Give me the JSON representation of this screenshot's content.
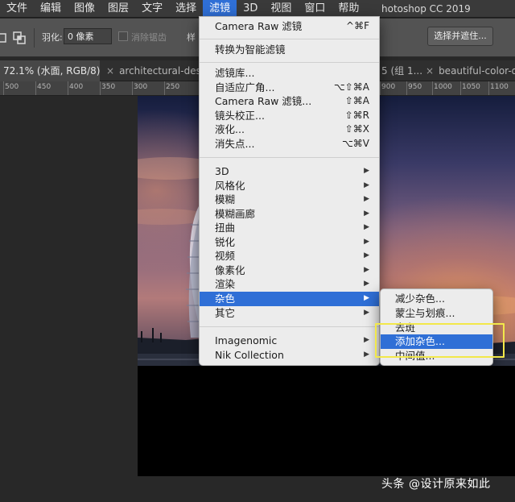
{
  "menubar": {
    "items": [
      "文件",
      "编辑",
      "图像",
      "图层",
      "文字",
      "选择",
      "滤镜",
      "3D",
      "视图",
      "窗口",
      "帮助"
    ],
    "active_index": 6,
    "app_title": "hotoshop CC 2019"
  },
  "options": {
    "feather_label": "羽化:",
    "feather_value": "0 像素",
    "antialias_label": "消除锯齿",
    "style_label": "样",
    "select_mask_label": "选择并遮住..."
  },
  "tabs": [
    {
      "label": "72.1% (水面, RGB/8) *",
      "close": "",
      "active": true
    },
    {
      "label": "architectural-desig",
      "close": "×",
      "active": false
    },
    {
      "label": "5 (组 1...",
      "close": "",
      "active": false
    },
    {
      "label": "beautiful-color-da",
      "close": "×",
      "active": false
    }
  ],
  "ruler": {
    "left_labels": [
      "500",
      "450",
      "400",
      "350",
      "300",
      "250"
    ],
    "right_labels": [
      "900",
      "950",
      "1000",
      "1050",
      "1100"
    ]
  },
  "filter_menu": {
    "items": [
      {
        "label": "Camera Raw 滤镜",
        "shortcut": "^⌘F"
      },
      {
        "label": "转换为智能滤镜",
        "shortcut": ""
      },
      {
        "label": "滤镜库...",
        "shortcut": ""
      },
      {
        "label": "自适应广角...",
        "shortcut": "⌥⇧⌘A"
      },
      {
        "label": "Camera Raw 滤镜...",
        "shortcut": "⇧⌘A"
      },
      {
        "label": "镜头校正...",
        "shortcut": "⇧⌘R"
      },
      {
        "label": "液化...",
        "shortcut": "⇧⌘X"
      },
      {
        "label": "消失点...",
        "shortcut": "⌥⌘V"
      },
      {
        "label": "3D",
        "submenu": true
      },
      {
        "label": "风格化",
        "submenu": true
      },
      {
        "label": "模糊",
        "submenu": true
      },
      {
        "label": "模糊画廊",
        "submenu": true
      },
      {
        "label": "扭曲",
        "submenu": true
      },
      {
        "label": "锐化",
        "submenu": true
      },
      {
        "label": "视频",
        "submenu": true
      },
      {
        "label": "像素化",
        "submenu": true
      },
      {
        "label": "渲染",
        "submenu": true
      },
      {
        "label": "杂色",
        "submenu": true,
        "highlighted": true
      },
      {
        "label": "其它",
        "submenu": true
      },
      {
        "label": "Imagenomic",
        "submenu": true
      },
      {
        "label": "Nik Collection",
        "submenu": true
      }
    ]
  },
  "noise_menu": {
    "items": [
      {
        "label": "减少杂色..."
      },
      {
        "label": "蒙尘与划痕..."
      },
      {
        "label": "去斑"
      },
      {
        "label": "添加杂色...",
        "highlighted": true
      },
      {
        "label": "中间值..."
      }
    ]
  },
  "watermark": "头条 @设计原来如此",
  "colors": {
    "highlight": "#2f6fd6",
    "annotation": "#f2e84a",
    "menu_bg": "#ececec"
  }
}
